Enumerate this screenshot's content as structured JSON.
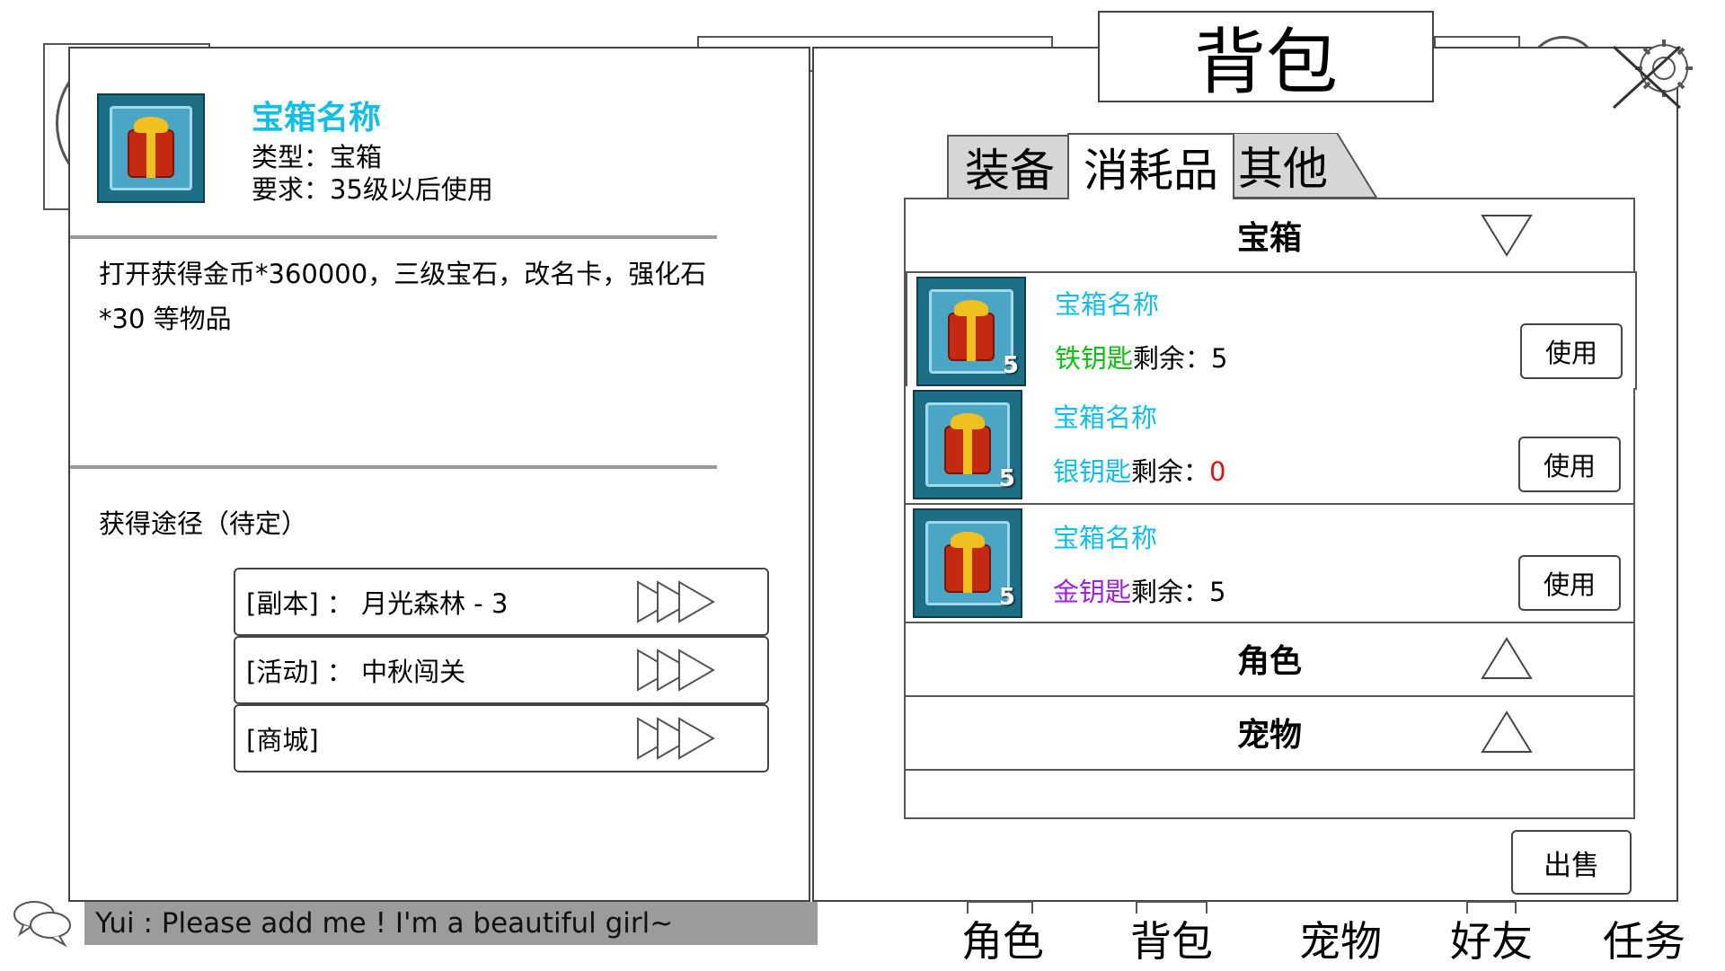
{
  "bag": {
    "title": "背包",
    "tabs": [
      {
        "label": "装备",
        "active": false
      },
      {
        "label": "消耗品",
        "active": true
      },
      {
        "label": "其他",
        "active": false
      }
    ],
    "categories": {
      "chest": {
        "label": "宝箱",
        "state": "expanded"
      },
      "role": {
        "label": "角色",
        "state": "collapsed"
      },
      "pet": {
        "label": "宠物",
        "state": "collapsed"
      }
    },
    "entries": [
      {
        "name": "宝箱名称",
        "count": "5",
        "key_name": "铁钥匙",
        "key_color": "#10c010",
        "remain_label": "剩余：",
        "remain_value": "5",
        "remain_color": "#000000",
        "use_label": "使用"
      },
      {
        "name": "宝箱名称",
        "count": "5",
        "key_name": "银钥匙",
        "key_color": "#12bde8",
        "remain_label": "剩余：",
        "remain_value": "0",
        "remain_color": "#e01010",
        "use_label": "使用"
      },
      {
        "name": "宝箱名称",
        "count": "5",
        "key_name": "金钥匙",
        "key_color": "#a020e0",
        "remain_label": "剩余：",
        "remain_value": "5",
        "remain_color": "#000000",
        "use_label": "使用"
      }
    ],
    "sell_label": "出售"
  },
  "detail": {
    "item_name": "宝箱名称",
    "type_line": "类型：宝箱",
    "requirement_line": "要求：35级以后使用",
    "description": "打开获得金币*360000，三级宝石，改名卡，强化石*30 等物品",
    "source_title": "获得途径（待定）",
    "sources": [
      {
        "label": "[副本] ： 月光森林 - 3"
      },
      {
        "label": "[活动] ： 中秋闯关"
      },
      {
        "label": "[商城]"
      }
    ]
  },
  "chat": {
    "message": "Yui : Please add me ! I'm a beautiful girl~"
  },
  "bottom_nav": [
    "角色",
    "背包",
    "宠物",
    "好友",
    "任务"
  ],
  "colors": {
    "item_title": "#12bde8",
    "chat_bg": "#9b9b9b",
    "border": "#444444"
  },
  "icons": [
    "chest-icon",
    "arrow-right-icon",
    "triangle-down-icon",
    "triangle-up-icon",
    "close-icon",
    "gear-icon",
    "chat-bubble-icon"
  ]
}
